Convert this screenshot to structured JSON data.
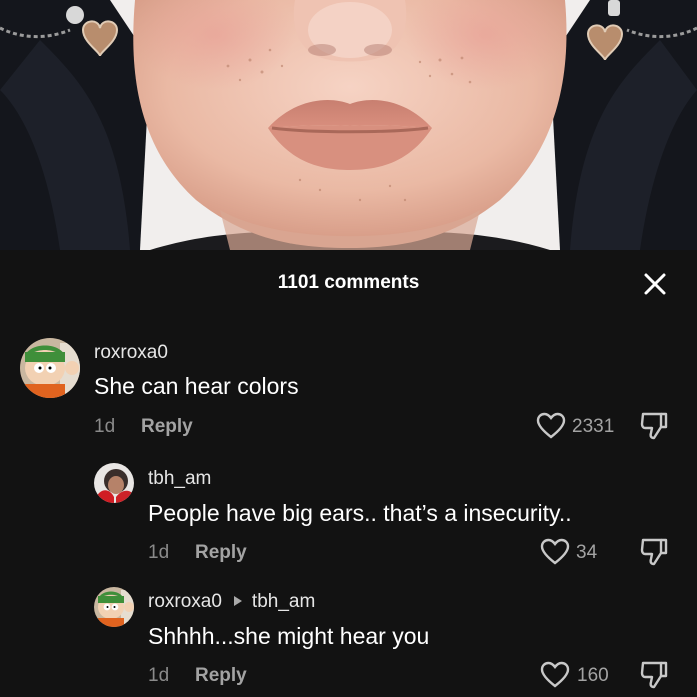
{
  "header": {
    "title": "1101 comments"
  },
  "comments": [
    {
      "username": "roxroxa0",
      "text": "She can hear colors",
      "time": "1d",
      "reply_label": "Reply",
      "likes": "2331"
    },
    {
      "username": "tbh_am",
      "text": "People have big ears.. that’s a insecurity..",
      "time": "1d",
      "reply_label": "Reply",
      "likes": "34"
    },
    {
      "username": "roxroxa0",
      "reply_to": "tbh_am",
      "text": "Shhhh...she might hear you",
      "time": "1d",
      "reply_label": "Reply",
      "likes": "160"
    }
  ],
  "colors": {
    "sheet_bg": "#121212",
    "text": "#ffffff",
    "muted": "#8a8a8a"
  }
}
